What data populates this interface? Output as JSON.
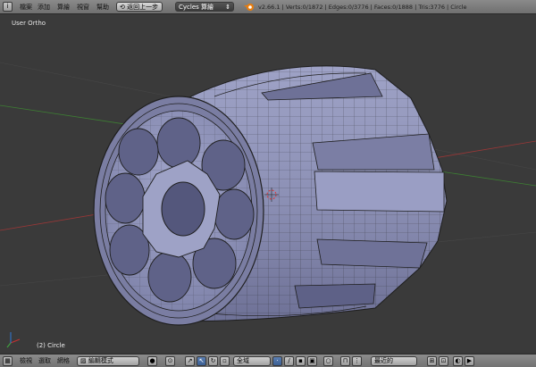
{
  "top_menu": {
    "items": [
      "檔案",
      "添加",
      "算繪",
      "視窗",
      "幫助"
    ],
    "undo_label": "返回上一步",
    "render_engine": "Cycles 算繪",
    "stats": "v2.66.1 | Verts:0/1872 | Edges:0/3776 | Faces:0/1888 | Tris:3776 | Circle"
  },
  "viewport": {
    "view_label": "User Ortho",
    "object_label": "(2) Circle"
  },
  "bottom_bar": {
    "menus": [
      "檢視",
      "選取",
      "網格"
    ],
    "mode": "編輯模式",
    "orientation": "全域",
    "snap_target": "最近的"
  },
  "colors": {
    "mesh_face": "#8e93b8",
    "mesh_dark": "#5d6085",
    "wire": "#1f1f1f",
    "x_axis": "#b54040",
    "y_axis": "#4c9a3f",
    "grid": "#4a4a4a"
  }
}
